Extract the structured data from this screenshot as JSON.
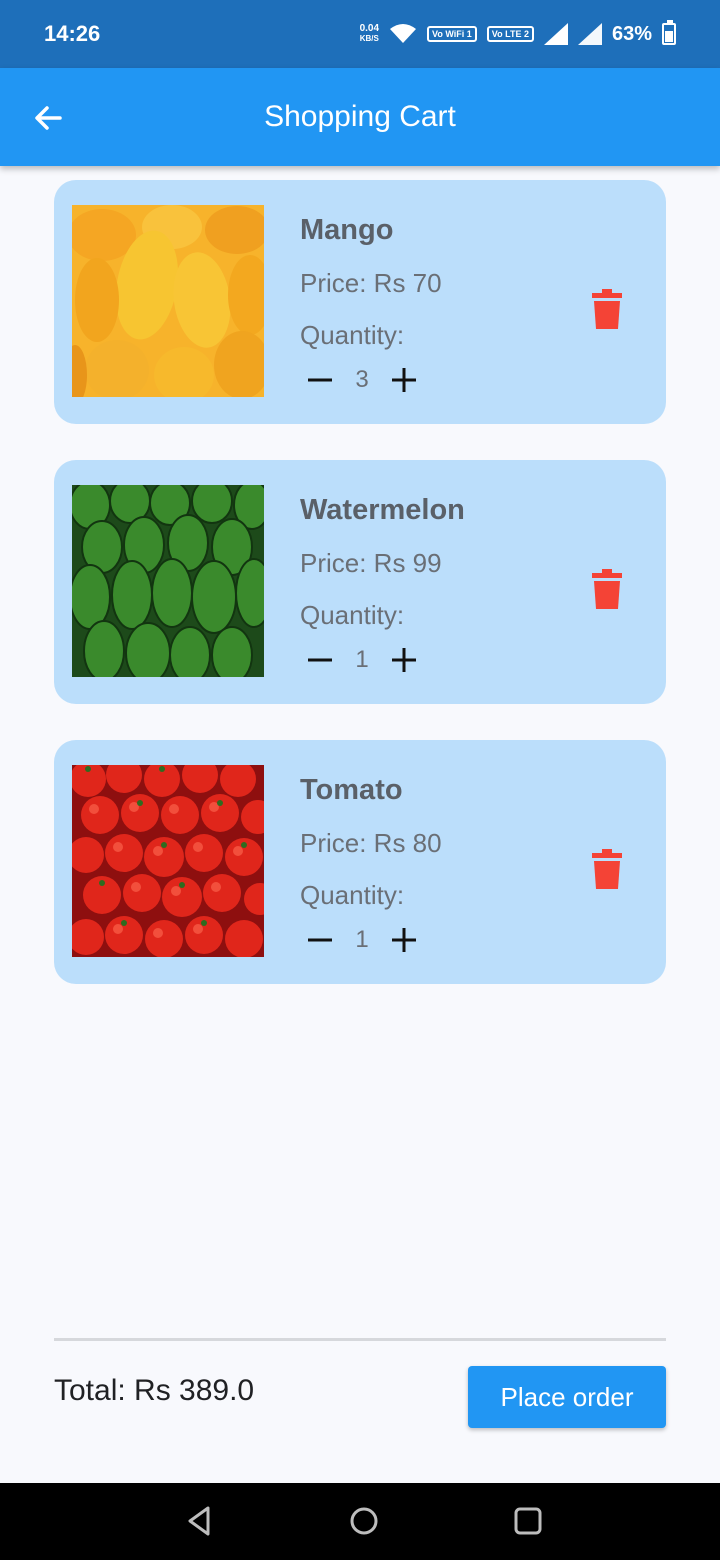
{
  "status_bar": {
    "time": "14:26",
    "net_speed_value": "0.04",
    "net_speed_unit": "KB/S",
    "vowifi_label": "Vo WiFi 1",
    "volte_label": "Vo LTE 2",
    "battery_percent": "63%",
    "battery_level": 0.63
  },
  "app_bar": {
    "title": "Shopping Cart",
    "back_icon": "arrow-left-icon"
  },
  "cart": {
    "items": [
      {
        "name": "Mango",
        "price": "Price: Rs 70",
        "quantity_label": "Quantity:",
        "quantity": "3",
        "image": "mango-photo"
      },
      {
        "name": "Watermelon",
        "price": "Price: Rs 99",
        "quantity_label": "Quantity:",
        "quantity": "1",
        "image": "watermelon-photo"
      },
      {
        "name": "Tomato",
        "price": "Price: Rs 80",
        "quantity_label": "Quantity:",
        "quantity": "1",
        "image": "tomato-photo"
      }
    ]
  },
  "footer": {
    "total": "Total: Rs 389.0",
    "place_order": "Place order"
  },
  "colors": {
    "primary": "#2196f3",
    "card": "#bbdefb",
    "delete": "#f44336"
  }
}
